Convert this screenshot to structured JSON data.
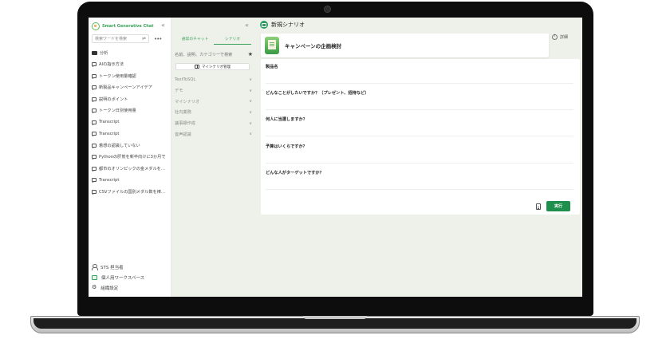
{
  "sidebar": {
    "brand": "Smart Generative Chat",
    "search_placeholder": "検索ワードを検索",
    "folder_label": "分析",
    "items": [
      "AIの指示方法",
      "トークン使用量確認",
      "新製品キャンペーンアイデア",
      "説明のポイント",
      "トークン日別使用量",
      "Transcript",
      "Transcript",
      "着想の認識していない",
      "Pythonの肝煎を新卒向けに3か月で",
      "都市のオリンピックの金メダルを…",
      "Transcript",
      "CSVファイルの国別メダル数を棒…"
    ],
    "bottom": {
      "user": "STS 担当者",
      "workspace": "個人用ワークスペース",
      "settings": "組織設定"
    }
  },
  "middle": {
    "tabs": [
      "通常のチャット",
      "シナリオ"
    ],
    "active_tab": "シナリオ",
    "search_placeholder": "名前、説明、カテゴリーで検索",
    "my_scenario_button": "マイシナリオ管理",
    "categories": [
      "TextToSQL",
      "デモ",
      "マイシナリオ",
      "社内業務",
      "議事録作成",
      "音声認識"
    ]
  },
  "main": {
    "header_title": "新規シナリオ",
    "scenario_title": "キャンペーンの企画検討",
    "detail_label": "詳細",
    "fields": [
      {
        "label": "製品名",
        "value": ""
      },
      {
        "label": "どんなことがしたいですか？（プレゼント、招待など）",
        "value": ""
      },
      {
        "label": "何人に当選しますか？",
        "value": ""
      },
      {
        "label": "予算はいくらですか？",
        "value": ""
      },
      {
        "label": "どんな人がターゲットですか？",
        "value": ""
      }
    ],
    "run_button": "実行"
  },
  "colors": {
    "accent_green": "#1f8f4e",
    "brand_green": "#3aa35a",
    "panel_bg": "#eef0ea"
  }
}
